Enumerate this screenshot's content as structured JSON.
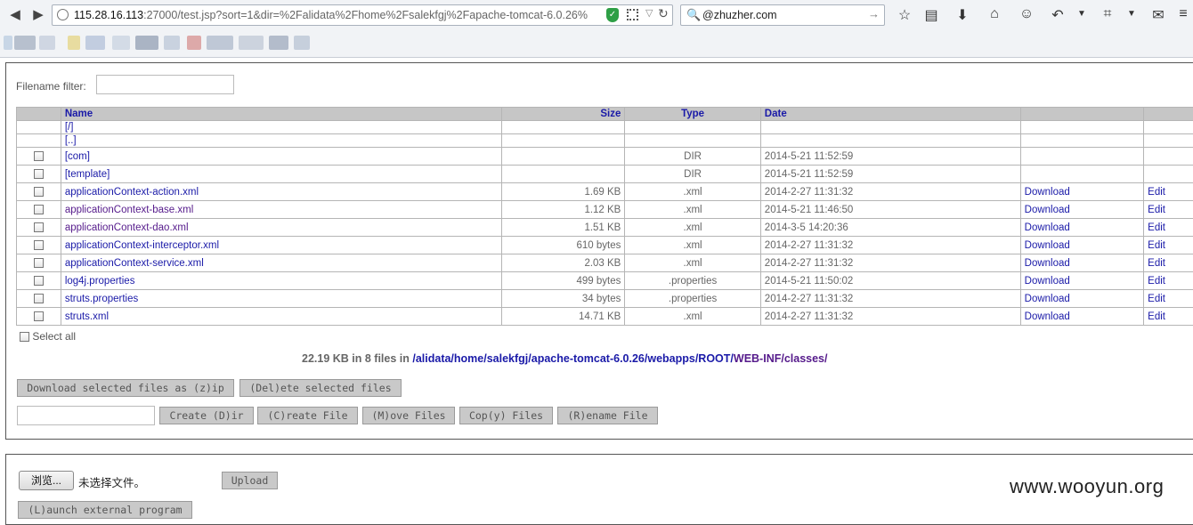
{
  "browser": {
    "url_host": "115.28.16.113",
    "url_rest": ":27000/test.jsp?sort=1&dir=%2Falidata%2Fhome%2Fsalekfgj%2Fapache-tomcat-6.0.26%",
    "search_value": "@zhuzher.com"
  },
  "page": {
    "filter_label": "Filename filter:",
    "columns": {
      "name": "Name",
      "size": "Size",
      "type": "Type",
      "date": "Date"
    },
    "nav_root": "[/]",
    "nav_up": "[..]",
    "files": [
      {
        "name": "[com]",
        "size": "",
        "type": "DIR",
        "date": "2014-5-21 11:52:59",
        "download": "",
        "edit": ""
      },
      {
        "name": "[template]",
        "size": "",
        "type": "DIR",
        "date": "2014-5-21 11:52:59",
        "download": "",
        "edit": ""
      },
      {
        "name": "applicationContext-action.xml",
        "size": "1.69 KB",
        "type": ".xml",
        "date": "2014-2-27 11:31:32",
        "download": "Download",
        "edit": "Edit"
      },
      {
        "name": "applicationContext-base.xml",
        "size": "1.12 KB",
        "type": ".xml",
        "date": "2014-5-21 11:46:50",
        "download": "Download",
        "edit": "Edit"
      },
      {
        "name": "applicationContext-dao.xml",
        "size": "1.51 KB",
        "type": ".xml",
        "date": "2014-3-5 14:20:36",
        "download": "Download",
        "edit": "Edit"
      },
      {
        "name": "applicationContext-interceptor.xml",
        "size": "610 bytes",
        "type": ".xml",
        "date": "2014-2-27 11:31:32",
        "download": "Download",
        "edit": "Edit"
      },
      {
        "name": "applicationContext-service.xml",
        "size": "2.03 KB",
        "type": ".xml",
        "date": "2014-2-27 11:31:32",
        "download": "Download",
        "edit": "Edit"
      },
      {
        "name": "log4j.properties",
        "size": "499 bytes",
        "type": ".properties",
        "date": "2014-5-21 11:50:02",
        "download": "Download",
        "edit": "Edit"
      },
      {
        "name": "struts.properties",
        "size": "34 bytes",
        "type": ".properties",
        "date": "2014-2-27 11:31:32",
        "download": "Download",
        "edit": "Edit"
      },
      {
        "name": "struts.xml",
        "size": "14.71 KB",
        "type": ".xml",
        "date": "2014-2-27 11:31:32",
        "download": "Download",
        "edit": "Edit"
      }
    ],
    "select_all": "Select all",
    "summary_text": "22.19 KB in 8 files in ",
    "summary_path_1": "/alidata/home/salekfgj/apache-tomcat-6.0.26/webapps/ROOT/",
    "summary_path_2": "WEB-INF/classes/",
    "buttons": {
      "download_zip": "Download selected files as (z)ip",
      "delete": "(Del)ete selected files",
      "create_dir": "Create (D)ir",
      "create_file": "(C)reate File",
      "move": "(M)ove Files",
      "copy": "Cop(y) Files",
      "rename": "(R)ename File",
      "browse": "浏览...",
      "no_file": "未选择文件。",
      "upload": "Upload",
      "launch": "(L)aunch external program"
    }
  },
  "watermark": "www.wooyun.org"
}
